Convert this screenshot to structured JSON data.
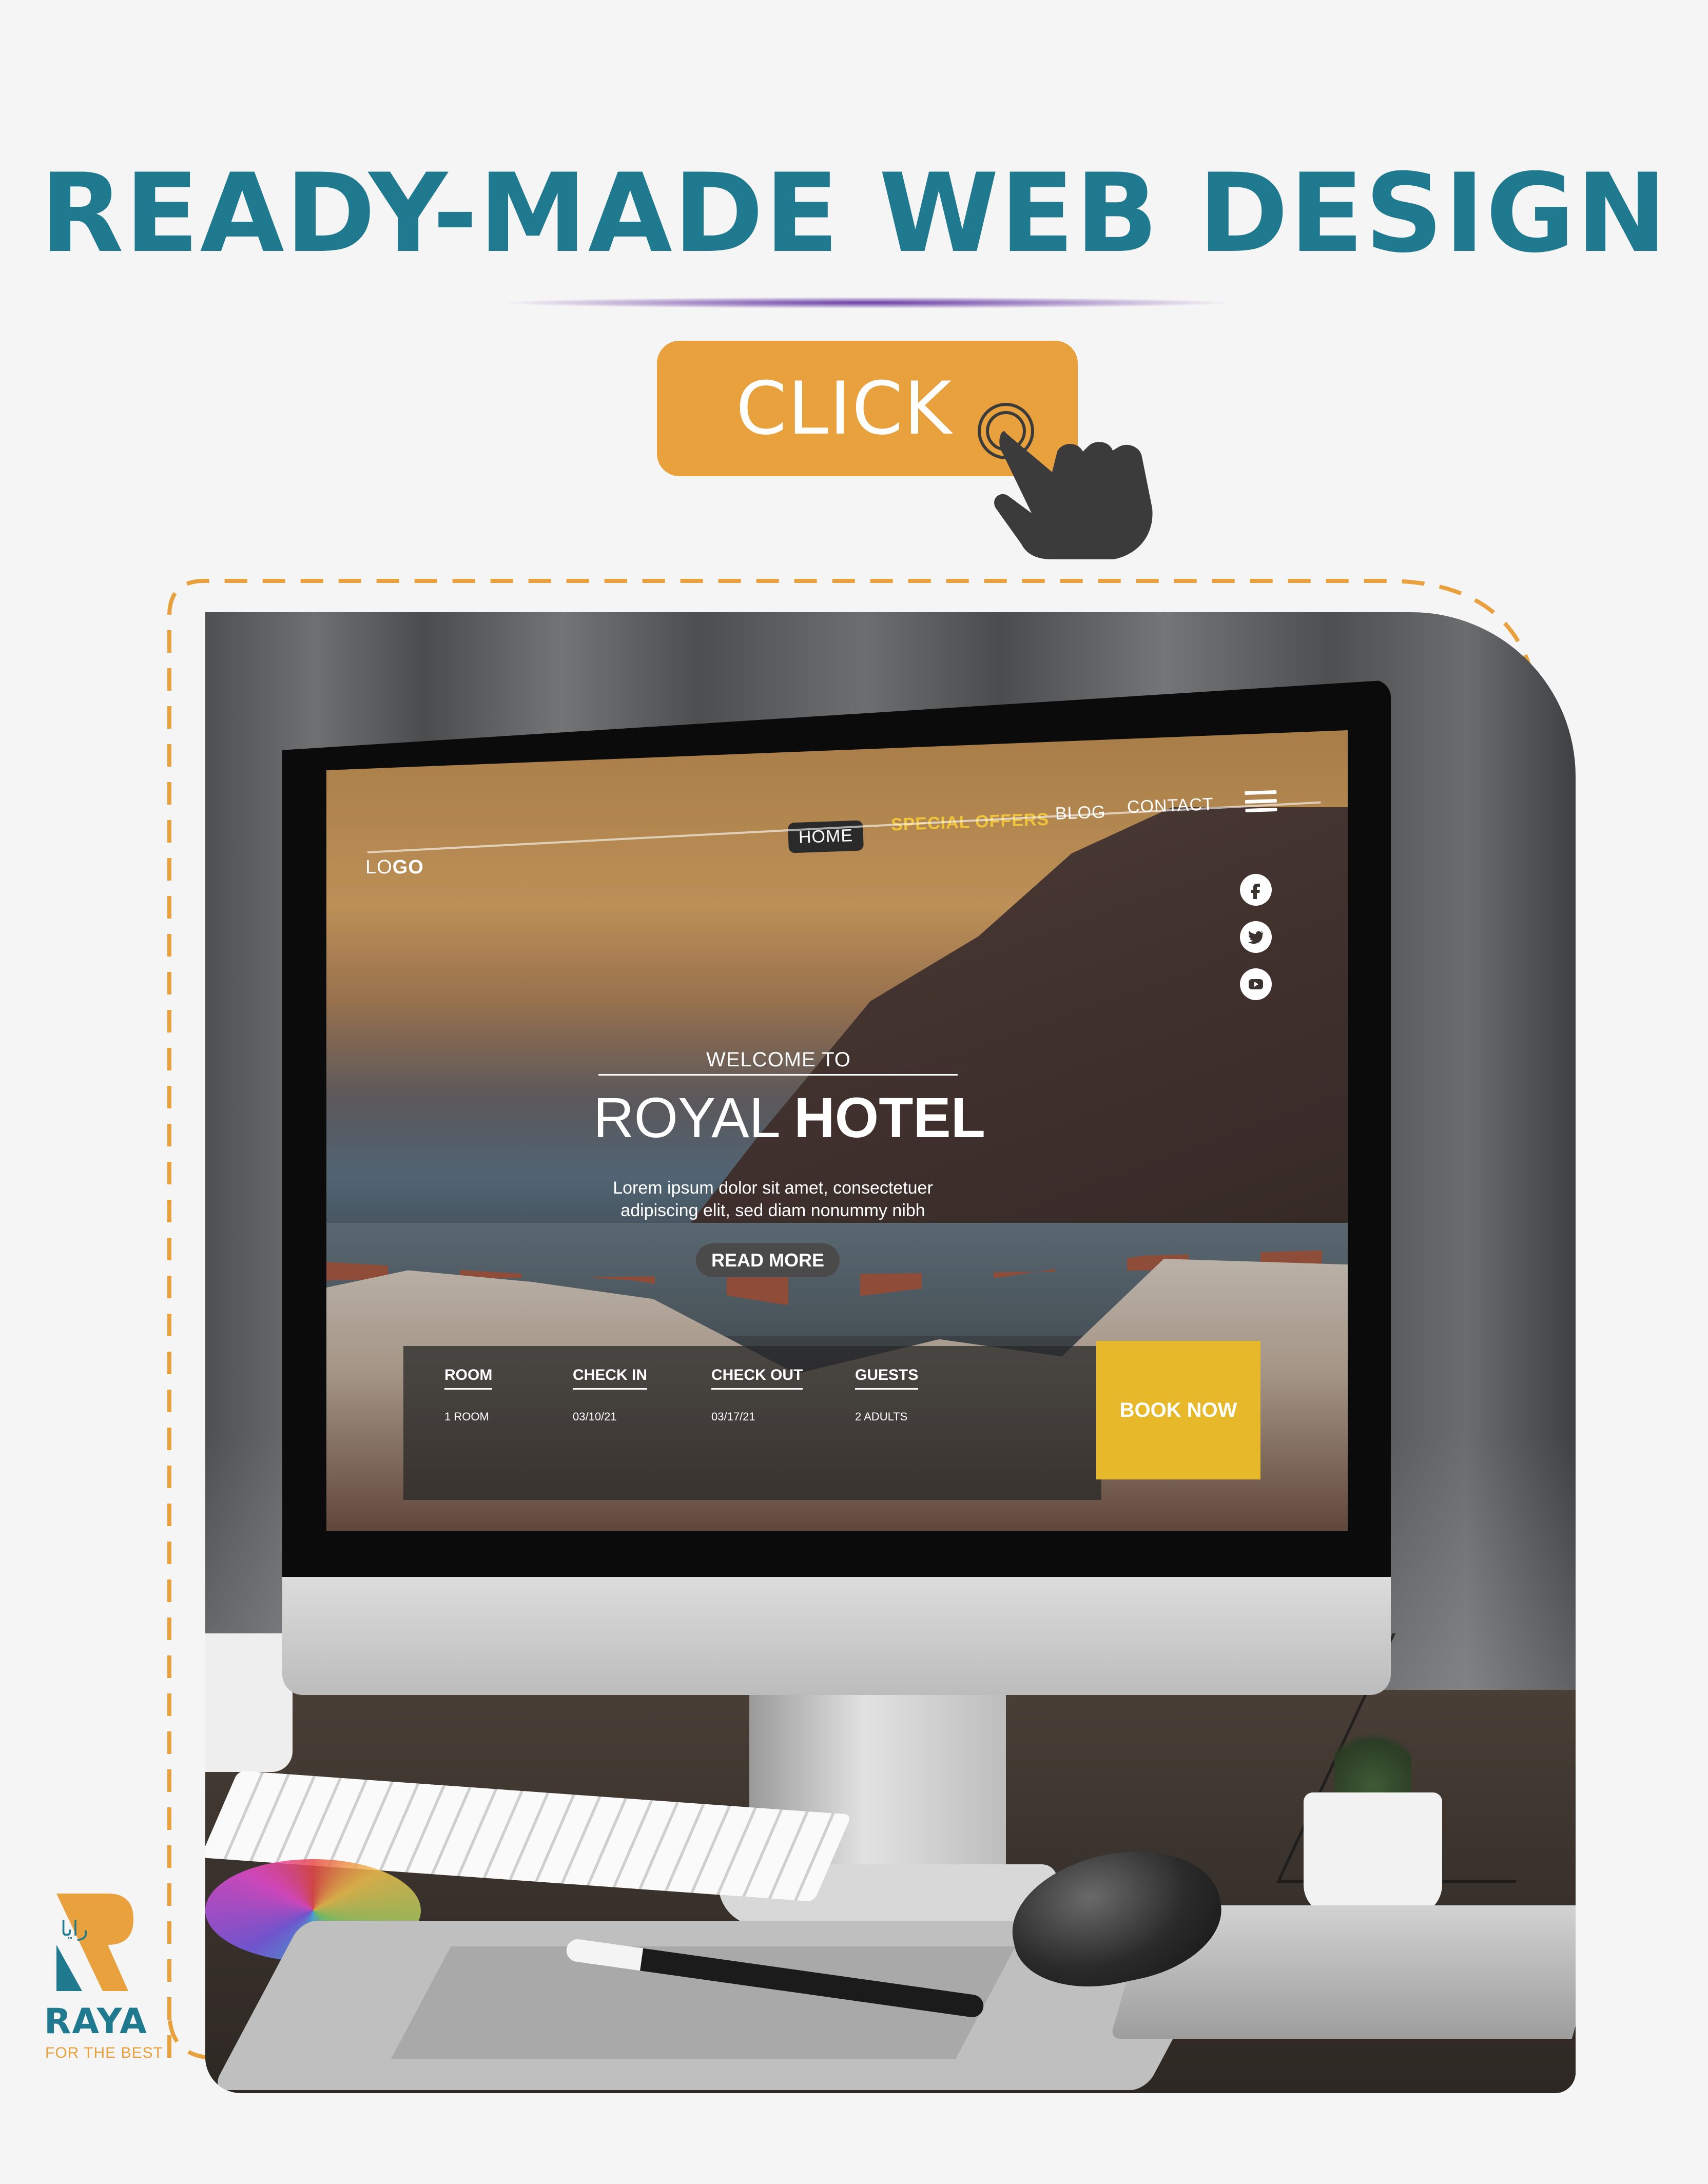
{
  "headline": "READY-MADE WEB DESIGN",
  "cta_label": "CLICK",
  "colors": {
    "headline": "#207a8f",
    "cta_background": "#e8a13c",
    "dashed_frame": "#e8a13c",
    "accent_yellow": "#e7b92a"
  },
  "icons": [
    "hand-pointer-icon",
    "facebook-icon",
    "twitter-icon",
    "youtube-icon",
    "menu-icon"
  ],
  "website": {
    "logo": {
      "part1": "LO",
      "part2": "GO"
    },
    "nav": {
      "home": "HOME",
      "special_offers": "SPECIAL OFFERS",
      "blog": "BLOG",
      "contact": "CONTACT"
    },
    "hero": {
      "welcome": "WELCOME TO",
      "title_light": "ROYAL ",
      "title_bold": "HOTEL",
      "text": "Lorem ipsum dolor sit amet, consectetuer adipiscing elit, sed diam nonummy nibh",
      "read_more": "READ MORE"
    },
    "booking": {
      "room_label": "ROOM",
      "room_value": "1 ROOM",
      "check_in_label": "CHECK IN",
      "check_in_value": "03/10/21",
      "check_out_label": "CHECK OUT",
      "check_out_value": "03/17/21",
      "guests_label": "GUESTS",
      "guests_value": "2  ADULTS",
      "book_now": "BOOK NOW"
    }
  },
  "brand": {
    "arabic_mark": "رايا",
    "name": "RAYA",
    "tagline": "FOR THE BEST"
  }
}
